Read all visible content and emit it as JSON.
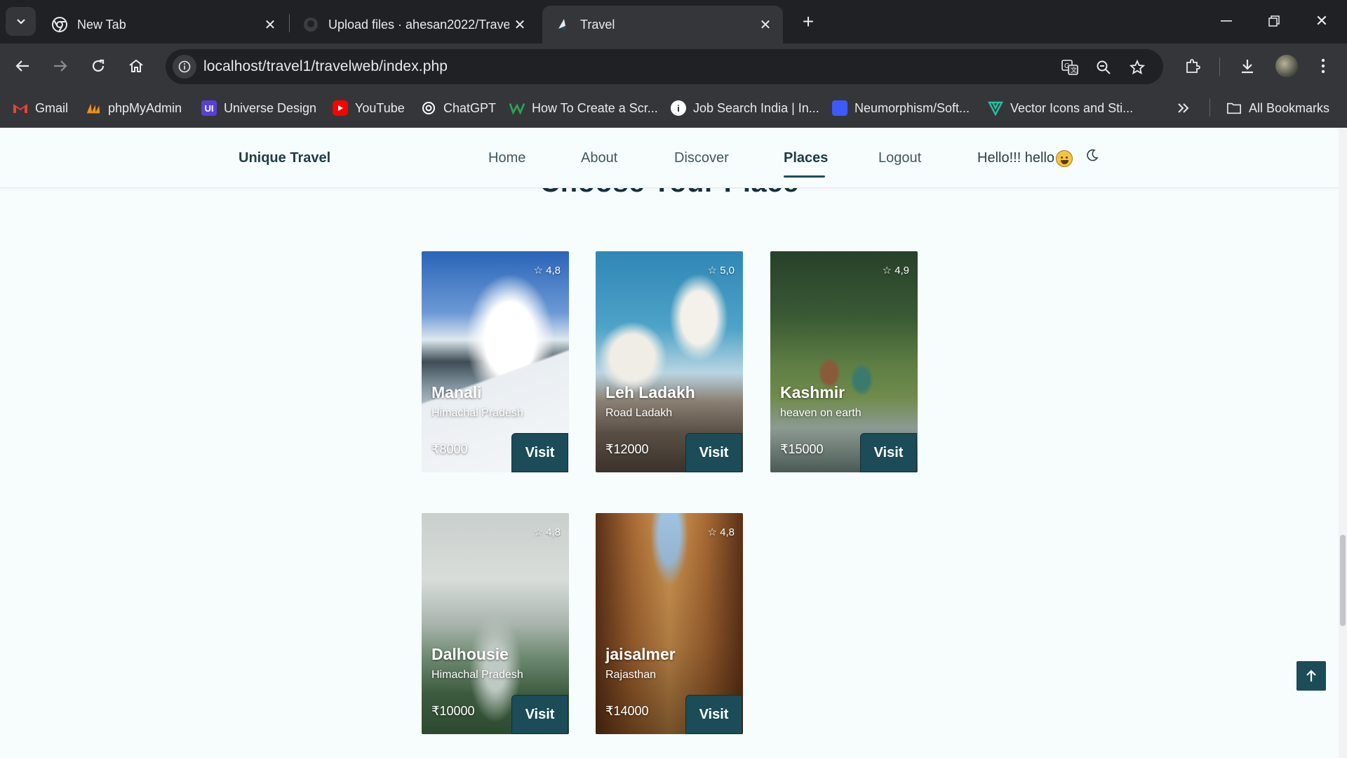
{
  "browser": {
    "tabs": [
      {
        "title": "New Tab",
        "favicon": "chrome-icon"
      },
      {
        "title": "Upload files · ahesan2022/Trave",
        "favicon": "github-icon"
      },
      {
        "title": "Travel",
        "favicon": "site-icon",
        "active": true
      }
    ],
    "url": "localhost/travel1/travelweb/index.php",
    "bookmarks": [
      {
        "label": "Gmail",
        "icon": "gmail-icon",
        "color": "#ea4335"
      },
      {
        "label": "phpMyAdmin",
        "icon": "phpmyadmin-icon",
        "color": "#f29111"
      },
      {
        "label": "Universe Design",
        "icon": "ui-icon",
        "color": "#5a3fd8"
      },
      {
        "label": "YouTube",
        "icon": "youtube-icon",
        "color": "#ff0000"
      },
      {
        "label": "ChatGPT",
        "icon": "chatgpt-icon",
        "color": "#ffffff"
      },
      {
        "label": "How To Create a Scr...",
        "icon": "w-icon",
        "color": "#2aa44f"
      },
      {
        "label": "Job Search India | In...",
        "icon": "info-icon",
        "color": "#ffffff"
      },
      {
        "label": "Neumorphism/Soft...",
        "icon": "neumorphism-icon",
        "color": "#3d5afe"
      },
      {
        "label": "Vector Icons and Sti...",
        "icon": "vector-icon",
        "color": "#1bc5a4"
      }
    ],
    "all_bookmarks": "All Bookmarks"
  },
  "site": {
    "logo": "Unique Travel",
    "nav": [
      "Home",
      "About",
      "Discover",
      "Places",
      "Logout"
    ],
    "active_nav": "Places",
    "greeting": "Hello!!! hello",
    "section_title": "Choose Your Place"
  },
  "cards": [
    {
      "name": "Manali",
      "sub": "Himachal Pradesh",
      "price": "₹8000",
      "rating": "4,8",
      "visit": "Visit"
    },
    {
      "name": "Leh Ladakh",
      "sub": "Road Ladakh",
      "price": "₹12000",
      "rating": "5,0",
      "visit": "Visit"
    },
    {
      "name": "Kashmir",
      "sub": "heaven on earth",
      "price": "₹15000",
      "rating": "4,9",
      "visit": "Visit"
    },
    {
      "name": "Dalhousie",
      "sub": "Himachal Pradesh",
      "price": "₹10000",
      "rating": "4,8",
      "visit": "Visit"
    },
    {
      "name": "jaisalmer",
      "sub": "Rajasthan",
      "price": "₹14000",
      "rating": "4,8",
      "visit": "Visit"
    }
  ],
  "colors": {
    "accent": "#1b4c58",
    "chrome_dark": "#202124",
    "chrome_mid": "#35363a"
  }
}
